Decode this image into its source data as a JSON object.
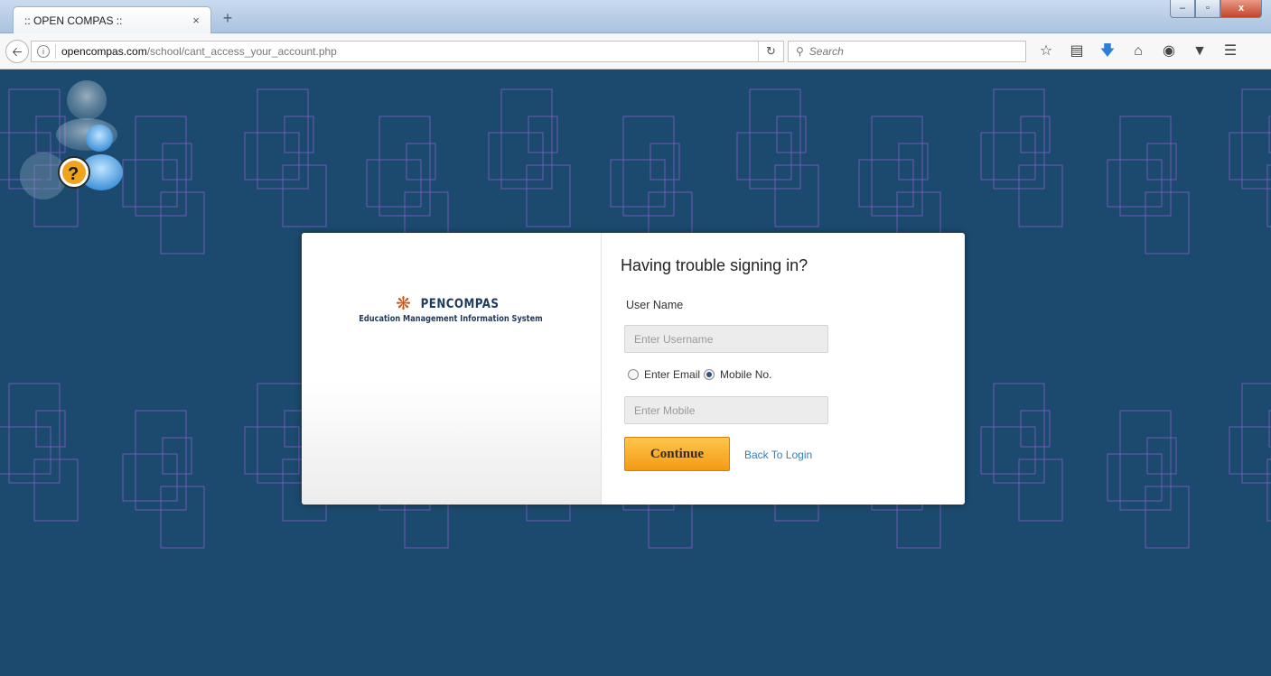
{
  "browser": {
    "tab_title": ":: OPEN COMPAS ::",
    "tab_close": "×",
    "new_tab": "+",
    "window_min": "‒",
    "window_max": "▫",
    "window_close": "x",
    "url_host": "opencompas.com",
    "url_path": "/school/cant_access_your_account.php",
    "search_placeholder": "Search",
    "toolbar_icons": [
      "star-icon",
      "reading-list-icon",
      "download-icon",
      "home-icon",
      "chat-icon",
      "pocket-icon",
      "menu-icon"
    ]
  },
  "logo": {
    "name": "PENCOMPAS",
    "tagline": "Education Management Information System"
  },
  "form": {
    "heading": "Having trouble signing in?",
    "username_label": "User Name",
    "username_placeholder": "Enter Username",
    "option_email": "Enter Email",
    "option_mobile": "Mobile No.",
    "selected_option": "Mobile No.",
    "mobile_placeholder": "Enter Mobile",
    "continue_label": "Continue",
    "back_link": "Back To Login"
  },
  "colors": {
    "background": "#1b4a6e",
    "pattern_stroke": "#8a5fd0",
    "button": "#f5a623",
    "link": "#2f7fc2"
  }
}
